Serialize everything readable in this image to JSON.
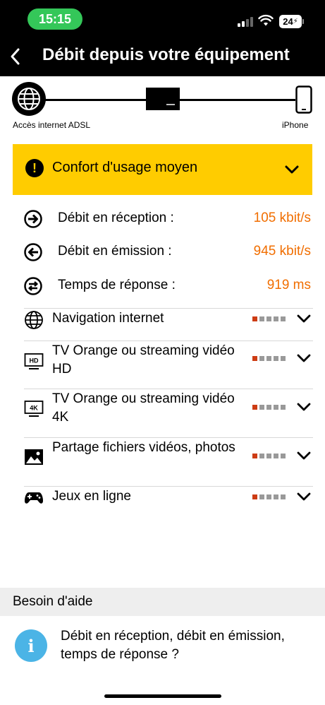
{
  "status_bar": {
    "time": "15:15",
    "battery": "24",
    "time_pill_color": "#34c759"
  },
  "nav": {
    "title": "Débit depuis votre équipement",
    "back_icon": "chevron-left-icon"
  },
  "connection": {
    "left_label": "Accès internet ADSL",
    "right_label": "iPhone",
    "left_icon": "globe-icon",
    "middle_icon": "livebox-icon",
    "right_icon": "smartphone-icon"
  },
  "banner": {
    "text": "Confort d'usage moyen",
    "color": "#ffcc00",
    "icon": "exclamation-icon"
  },
  "metrics": [
    {
      "label": "Débit en réception :",
      "value": "105 kbit/s",
      "icon": "arrow-right-circle-icon"
    },
    {
      "label": "Débit en émission :",
      "value": "945 kbit/s",
      "icon": "arrow-left-circle-icon"
    },
    {
      "label": "Temps de réponse :",
      "value": "919 ms",
      "icon": "swap-arrows-circle-icon"
    }
  ],
  "metric_value_color": "#f16e00",
  "usages": [
    {
      "label": "Navigation internet",
      "icon": "globe-icon",
      "rating": 1,
      "max_rating": 5
    },
    {
      "label": "TV Orange ou streaming vidéo HD",
      "icon": "hd-tv-icon",
      "rating": 1,
      "max_rating": 5
    },
    {
      "label": "TV Orange ou streaming vidéo 4K",
      "icon": "4k-tv-icon",
      "rating": 1,
      "max_rating": 5
    },
    {
      "label": "Partage fichiers vidéos, photos",
      "icon": "image-icon",
      "rating": 1,
      "max_rating": 5
    },
    {
      "label": "Jeux en ligne",
      "icon": "gamepad-icon",
      "rating": 1,
      "max_rating": 5
    }
  ],
  "rating_colors": {
    "filled": "#cd3c14",
    "empty": "#999999"
  },
  "help": {
    "title": "Besoin d'aide",
    "icon": "info-icon",
    "icon_letter": "i",
    "text": "Débit en réception, débit en émission, temps de réponse ?",
    "icon_color": "#4bb4e6"
  }
}
